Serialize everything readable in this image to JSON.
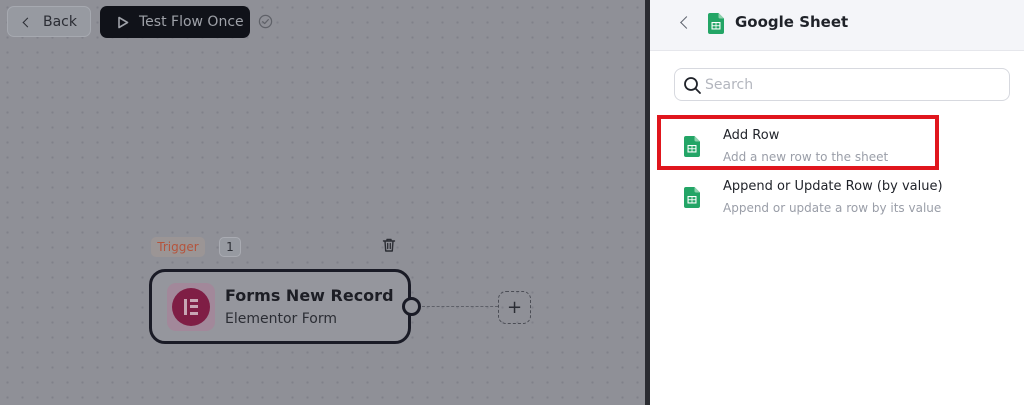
{
  "toolbar": {
    "back_label": "Back",
    "test_label": "Test Flow Once"
  },
  "flow": {
    "trigger_badge": "Trigger",
    "step_count": "1",
    "node": {
      "title": "Forms New Record",
      "subtitle": "Elementor Form"
    },
    "add_symbol": "+"
  },
  "panel": {
    "title": "Google Sheet",
    "search_placeholder": "Search",
    "actions": [
      {
        "title": "Add Row",
        "description": "Add a new row to the sheet",
        "highlighted": true
      },
      {
        "title": "Append or Update Row (by value)",
        "description": "Append or update a row by its value",
        "highlighted": false
      }
    ]
  },
  "colors": {
    "sheet_green": "#23a566",
    "elementor_brand": "#92003b",
    "highlight_red": "#e0161d",
    "dark_button": "#101219"
  },
  "icons": [
    "chevron-left-icon",
    "play-icon",
    "check-circle-icon",
    "trash-icon",
    "elementor-icon",
    "google-sheet-icon",
    "search-icon",
    "plus-icon"
  ]
}
